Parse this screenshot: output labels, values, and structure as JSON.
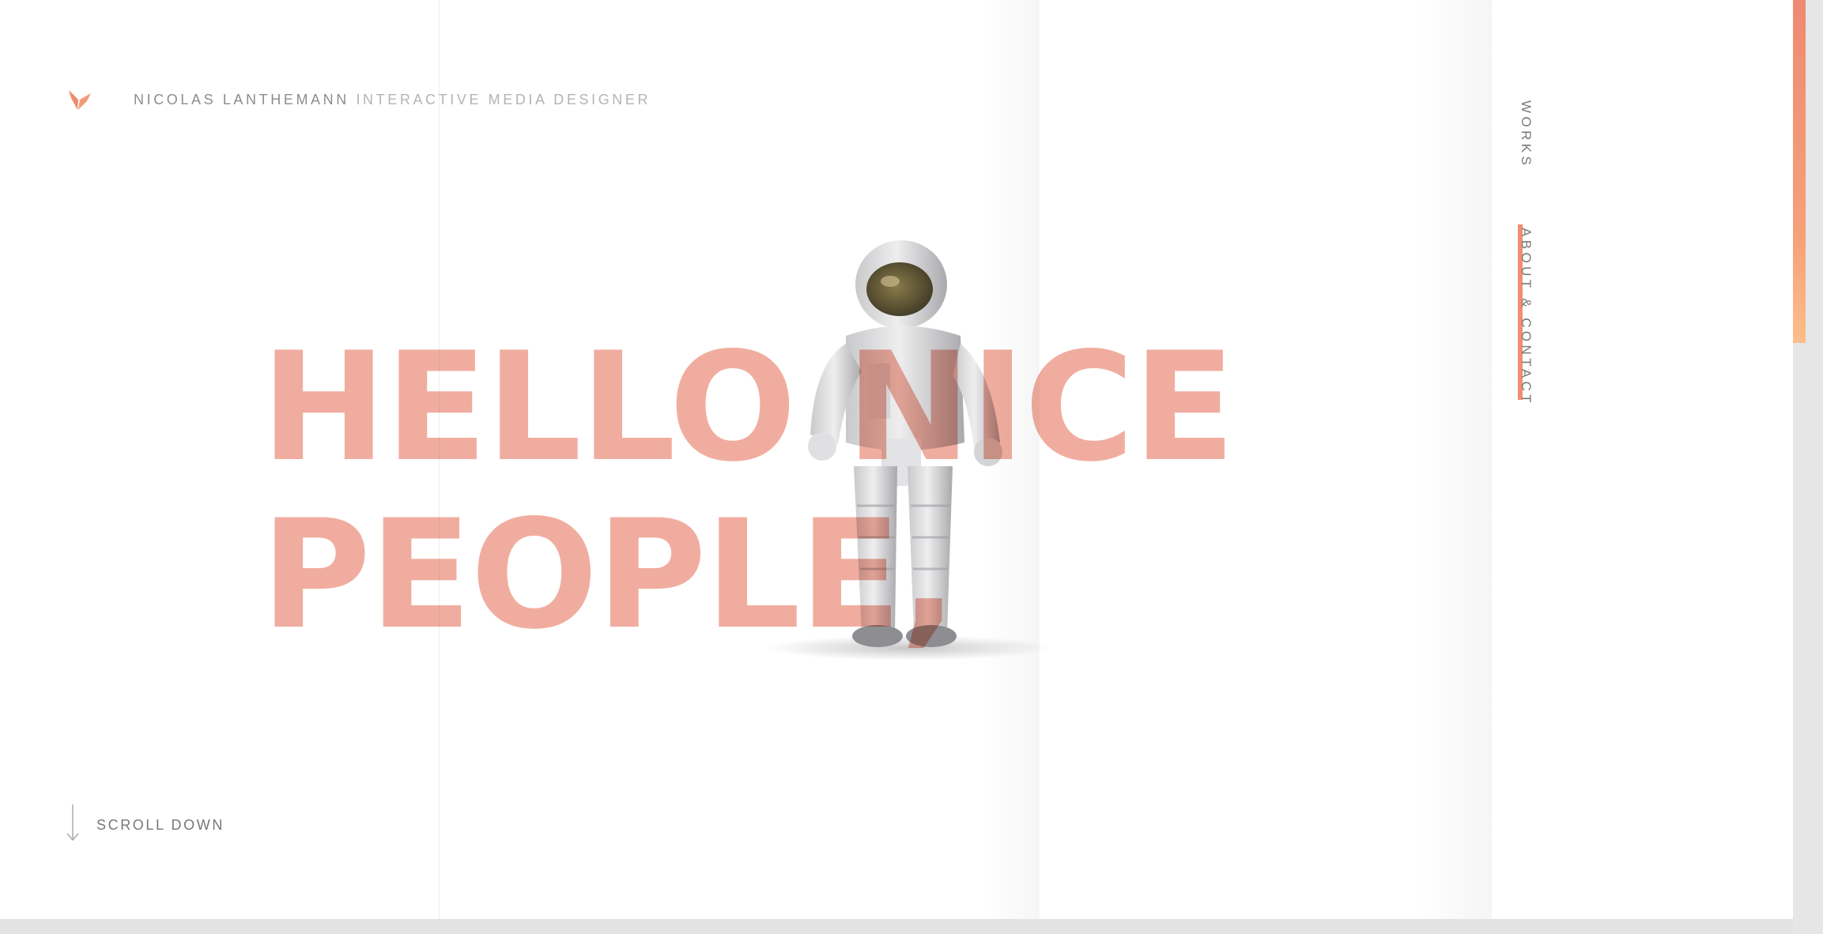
{
  "header": {
    "name": "NICOLAS LANTHEMANN",
    "role": "INTERACTIVE MEDIA DESIGNER"
  },
  "hero": {
    "line1": "HELLO NICE",
    "line2": "PEOPLE,"
  },
  "scroll": {
    "label": "SCROLL DOWN"
  },
  "nav": {
    "items": [
      {
        "label": "WORKS",
        "active": false
      },
      {
        "label": "ABOUT & CONTACT",
        "active": true
      }
    ]
  },
  "colors": {
    "accent": "#f08e6f",
    "hero_text": "#f0a99a",
    "scroll_thumb": "#f4a07c"
  },
  "icons": {
    "logo": "chevron-logo-icon",
    "scroll": "arrow-down-icon"
  }
}
